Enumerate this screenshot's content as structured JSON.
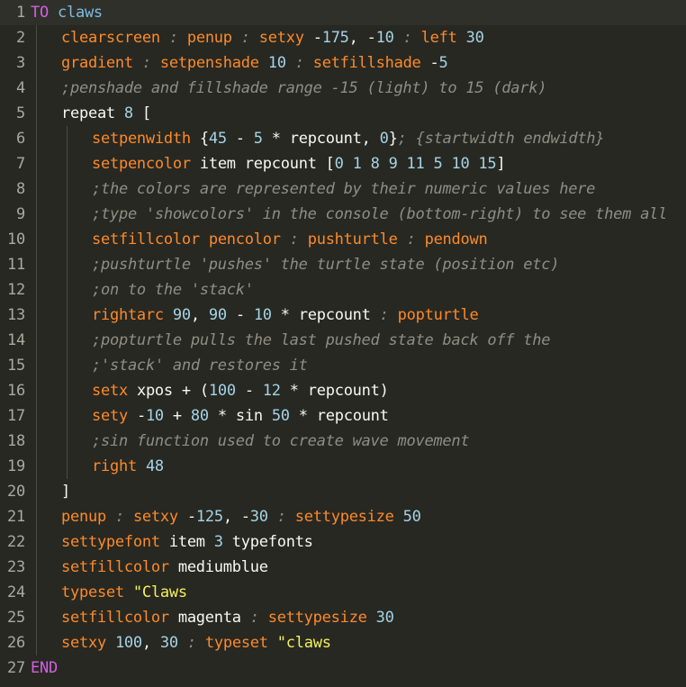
{
  "editor": {
    "language": "Logo",
    "lines": [
      {
        "n": "1",
        "indent": 0,
        "tokens": [
          [
            "kw",
            "TO"
          ],
          [
            "op",
            " "
          ],
          [
            "nm",
            "claws"
          ]
        ]
      },
      {
        "n": "2",
        "indent": 1,
        "tokens": [
          [
            "cmd",
            "clearscreen"
          ],
          [
            "op",
            " "
          ],
          [
            "cmt",
            ":"
          ],
          [
            "op",
            " "
          ],
          [
            "cmd",
            "penup"
          ],
          [
            "op",
            " "
          ],
          [
            "cmt",
            ":"
          ],
          [
            "op",
            " "
          ],
          [
            "cmd",
            "setxy"
          ],
          [
            "op",
            " -"
          ],
          [
            "num",
            "175"
          ],
          [
            "op",
            ", -"
          ],
          [
            "num",
            "10"
          ],
          [
            "op",
            " "
          ],
          [
            "cmt",
            ":"
          ],
          [
            "op",
            " "
          ],
          [
            "cmd",
            "left"
          ],
          [
            "op",
            " "
          ],
          [
            "num",
            "30"
          ]
        ]
      },
      {
        "n": "3",
        "indent": 1,
        "tokens": [
          [
            "cmd",
            "gradient"
          ],
          [
            "op",
            " "
          ],
          [
            "cmt",
            ":"
          ],
          [
            "op",
            " "
          ],
          [
            "cmd",
            "setpenshade"
          ],
          [
            "op",
            " "
          ],
          [
            "num",
            "10"
          ],
          [
            "op",
            " "
          ],
          [
            "cmt",
            ":"
          ],
          [
            "op",
            " "
          ],
          [
            "cmd",
            "setfillshade"
          ],
          [
            "op",
            " -"
          ],
          [
            "num",
            "5"
          ]
        ]
      },
      {
        "n": "4",
        "indent": 1,
        "tokens": [
          [
            "cmt",
            ";penshade and fillshade range -15 (light) to 15 (dark)"
          ]
        ]
      },
      {
        "n": "5",
        "indent": 1,
        "tokens": [
          [
            "var",
            "repeat"
          ],
          [
            "op",
            " "
          ],
          [
            "num",
            "8"
          ],
          [
            "op",
            " ["
          ]
        ]
      },
      {
        "n": "6",
        "indent": 2,
        "tokens": [
          [
            "cmd",
            "setpenwidth"
          ],
          [
            "op",
            " {"
          ],
          [
            "num",
            "45"
          ],
          [
            "op",
            " - "
          ],
          [
            "num",
            "5"
          ],
          [
            "op",
            " * "
          ],
          [
            "var",
            "repcount"
          ],
          [
            "op",
            ", "
          ],
          [
            "num",
            "0"
          ],
          [
            "op",
            "}"
          ],
          [
            "cmt",
            "; {startwidth endwidth}"
          ]
        ]
      },
      {
        "n": "7",
        "indent": 2,
        "tokens": [
          [
            "cmd",
            "setpencolor"
          ],
          [
            "op",
            " "
          ],
          [
            "var",
            "item"
          ],
          [
            "op",
            " "
          ],
          [
            "var",
            "repcount"
          ],
          [
            "op",
            " ["
          ],
          [
            "num",
            "0 1 8 9 11 5 10 15"
          ],
          [
            "op",
            "]"
          ]
        ]
      },
      {
        "n": "8",
        "indent": 2,
        "tokens": [
          [
            "cmt",
            ";the colors are represented by their numeric values here"
          ]
        ]
      },
      {
        "n": "9",
        "indent": 2,
        "tokens": [
          [
            "cmt",
            ";type 'showcolors' in the console (bottom-right) to see them all"
          ]
        ]
      },
      {
        "n": "10",
        "indent": 2,
        "tokens": [
          [
            "cmd",
            "setfillcolor"
          ],
          [
            "op",
            " "
          ],
          [
            "cmd",
            "pencolor"
          ],
          [
            "op",
            " "
          ],
          [
            "cmt",
            ":"
          ],
          [
            "op",
            " "
          ],
          [
            "cmd",
            "pushturtle"
          ],
          [
            "op",
            " "
          ],
          [
            "cmt",
            ":"
          ],
          [
            "op",
            " "
          ],
          [
            "cmd",
            "pendown"
          ]
        ]
      },
      {
        "n": "11",
        "indent": 2,
        "tokens": [
          [
            "cmt",
            ";pushturtle 'pushes' the turtle state (position etc)"
          ]
        ]
      },
      {
        "n": "12",
        "indent": 2,
        "tokens": [
          [
            "cmt",
            ";on to the 'stack'"
          ]
        ]
      },
      {
        "n": "13",
        "indent": 2,
        "tokens": [
          [
            "cmd",
            "rightarc"
          ],
          [
            "op",
            " "
          ],
          [
            "num",
            "90"
          ],
          [
            "op",
            ", "
          ],
          [
            "num",
            "90"
          ],
          [
            "op",
            " - "
          ],
          [
            "num",
            "10"
          ],
          [
            "op",
            " * "
          ],
          [
            "var",
            "repcount"
          ],
          [
            "op",
            " "
          ],
          [
            "cmt",
            ":"
          ],
          [
            "op",
            " "
          ],
          [
            "cmd",
            "popturtle"
          ]
        ]
      },
      {
        "n": "14",
        "indent": 2,
        "tokens": [
          [
            "cmt",
            ";popturtle pulls the last pushed state back off the"
          ]
        ]
      },
      {
        "n": "15",
        "indent": 2,
        "tokens": [
          [
            "cmt",
            ";'stack' and restores it"
          ]
        ]
      },
      {
        "n": "16",
        "indent": 2,
        "tokens": [
          [
            "cmd",
            "setx"
          ],
          [
            "op",
            " "
          ],
          [
            "var",
            "xpos"
          ],
          [
            "op",
            " + ("
          ],
          [
            "num",
            "100"
          ],
          [
            "op",
            " - "
          ],
          [
            "num",
            "12"
          ],
          [
            "op",
            " * "
          ],
          [
            "var",
            "repcount"
          ],
          [
            "op",
            ")"
          ]
        ]
      },
      {
        "n": "17",
        "indent": 2,
        "tokens": [
          [
            "cmd",
            "sety"
          ],
          [
            "op",
            " -"
          ],
          [
            "num",
            "10"
          ],
          [
            "op",
            " + "
          ],
          [
            "num",
            "80"
          ],
          [
            "op",
            " * "
          ],
          [
            "var",
            "sin"
          ],
          [
            "op",
            " "
          ],
          [
            "num",
            "50"
          ],
          [
            "op",
            " * "
          ],
          [
            "var",
            "repcount"
          ]
        ]
      },
      {
        "n": "18",
        "indent": 2,
        "tokens": [
          [
            "cmt",
            ";sin function used to create wave movement"
          ]
        ]
      },
      {
        "n": "19",
        "indent": 2,
        "tokens": [
          [
            "cmd",
            "right"
          ],
          [
            "op",
            " "
          ],
          [
            "num",
            "48"
          ]
        ]
      },
      {
        "n": "20",
        "indent": 1,
        "tokens": [
          [
            "op",
            "]"
          ]
        ]
      },
      {
        "n": "21",
        "indent": 1,
        "tokens": [
          [
            "cmd",
            "penup"
          ],
          [
            "op",
            " "
          ],
          [
            "cmt",
            ":"
          ],
          [
            "op",
            " "
          ],
          [
            "cmd",
            "setxy"
          ],
          [
            "op",
            " -"
          ],
          [
            "num",
            "125"
          ],
          [
            "op",
            ", -"
          ],
          [
            "num",
            "30"
          ],
          [
            "op",
            " "
          ],
          [
            "cmt",
            ":"
          ],
          [
            "op",
            " "
          ],
          [
            "cmd",
            "settypesize"
          ],
          [
            "op",
            " "
          ],
          [
            "num",
            "50"
          ]
        ]
      },
      {
        "n": "22",
        "indent": 1,
        "tokens": [
          [
            "cmd",
            "settypefont"
          ],
          [
            "op",
            " "
          ],
          [
            "var",
            "item"
          ],
          [
            "op",
            " "
          ],
          [
            "num",
            "3"
          ],
          [
            "op",
            " "
          ],
          [
            "var",
            "typefonts"
          ]
        ]
      },
      {
        "n": "23",
        "indent": 1,
        "tokens": [
          [
            "cmd",
            "setfillcolor"
          ],
          [
            "op",
            " "
          ],
          [
            "var",
            "mediumblue"
          ]
        ]
      },
      {
        "n": "24",
        "indent": 1,
        "tokens": [
          [
            "cmd",
            "typeset"
          ],
          [
            "op",
            " "
          ],
          [
            "str",
            "\"Claws"
          ]
        ]
      },
      {
        "n": "25",
        "indent": 1,
        "tokens": [
          [
            "cmd",
            "setfillcolor"
          ],
          [
            "op",
            " "
          ],
          [
            "var",
            "magenta"
          ],
          [
            "op",
            " "
          ],
          [
            "cmt",
            ":"
          ],
          [
            "op",
            " "
          ],
          [
            "cmd",
            "settypesize"
          ],
          [
            "op",
            " "
          ],
          [
            "num",
            "30"
          ]
        ]
      },
      {
        "n": "26",
        "indent": 1,
        "tokens": [
          [
            "cmd",
            "setxy"
          ],
          [
            "op",
            " "
          ],
          [
            "num",
            "100"
          ],
          [
            "op",
            ", "
          ],
          [
            "num",
            "30"
          ],
          [
            "op",
            " "
          ],
          [
            "cmt",
            ":"
          ],
          [
            "op",
            " "
          ],
          [
            "cmd",
            "typeset"
          ],
          [
            "op",
            " "
          ],
          [
            "str",
            "\"claws"
          ]
        ]
      },
      {
        "n": "27",
        "indent": 0,
        "tokens": [
          [
            "kw",
            "END"
          ]
        ]
      }
    ]
  }
}
